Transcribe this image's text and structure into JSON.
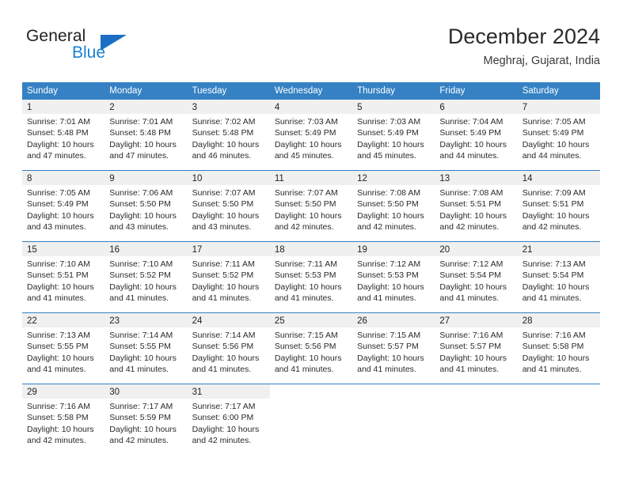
{
  "logo": {
    "word_top": "General",
    "word_bottom": "Blue",
    "triangle_icon": "blue-triangle-icon",
    "accent_color": "#1a7fd4"
  },
  "header": {
    "title": "December 2024",
    "location": "Meghraj, Gujarat, India"
  },
  "calendar": {
    "header_color": "#3581c4",
    "day_band_color": "#f0f0f0",
    "weekdays": [
      "Sunday",
      "Monday",
      "Tuesday",
      "Wednesday",
      "Thursday",
      "Friday",
      "Saturday"
    ],
    "weeks": [
      [
        {
          "day": "1",
          "sunrise": "Sunrise: 7:01 AM",
          "sunset": "Sunset: 5:48 PM",
          "daylight1": "Daylight: 10 hours",
          "daylight2": "and 47 minutes."
        },
        {
          "day": "2",
          "sunrise": "Sunrise: 7:01 AM",
          "sunset": "Sunset: 5:48 PM",
          "daylight1": "Daylight: 10 hours",
          "daylight2": "and 47 minutes."
        },
        {
          "day": "3",
          "sunrise": "Sunrise: 7:02 AM",
          "sunset": "Sunset: 5:48 PM",
          "daylight1": "Daylight: 10 hours",
          "daylight2": "and 46 minutes."
        },
        {
          "day": "4",
          "sunrise": "Sunrise: 7:03 AM",
          "sunset": "Sunset: 5:49 PM",
          "daylight1": "Daylight: 10 hours",
          "daylight2": "and 45 minutes."
        },
        {
          "day": "5",
          "sunrise": "Sunrise: 7:03 AM",
          "sunset": "Sunset: 5:49 PM",
          "daylight1": "Daylight: 10 hours",
          "daylight2": "and 45 minutes."
        },
        {
          "day": "6",
          "sunrise": "Sunrise: 7:04 AM",
          "sunset": "Sunset: 5:49 PM",
          "daylight1": "Daylight: 10 hours",
          "daylight2": "and 44 minutes."
        },
        {
          "day": "7",
          "sunrise": "Sunrise: 7:05 AM",
          "sunset": "Sunset: 5:49 PM",
          "daylight1": "Daylight: 10 hours",
          "daylight2": "and 44 minutes."
        }
      ],
      [
        {
          "day": "8",
          "sunrise": "Sunrise: 7:05 AM",
          "sunset": "Sunset: 5:49 PM",
          "daylight1": "Daylight: 10 hours",
          "daylight2": "and 43 minutes."
        },
        {
          "day": "9",
          "sunrise": "Sunrise: 7:06 AM",
          "sunset": "Sunset: 5:50 PM",
          "daylight1": "Daylight: 10 hours",
          "daylight2": "and 43 minutes."
        },
        {
          "day": "10",
          "sunrise": "Sunrise: 7:07 AM",
          "sunset": "Sunset: 5:50 PM",
          "daylight1": "Daylight: 10 hours",
          "daylight2": "and 43 minutes."
        },
        {
          "day": "11",
          "sunrise": "Sunrise: 7:07 AM",
          "sunset": "Sunset: 5:50 PM",
          "daylight1": "Daylight: 10 hours",
          "daylight2": "and 42 minutes."
        },
        {
          "day": "12",
          "sunrise": "Sunrise: 7:08 AM",
          "sunset": "Sunset: 5:50 PM",
          "daylight1": "Daylight: 10 hours",
          "daylight2": "and 42 minutes."
        },
        {
          "day": "13",
          "sunrise": "Sunrise: 7:08 AM",
          "sunset": "Sunset: 5:51 PM",
          "daylight1": "Daylight: 10 hours",
          "daylight2": "and 42 minutes."
        },
        {
          "day": "14",
          "sunrise": "Sunrise: 7:09 AM",
          "sunset": "Sunset: 5:51 PM",
          "daylight1": "Daylight: 10 hours",
          "daylight2": "and 42 minutes."
        }
      ],
      [
        {
          "day": "15",
          "sunrise": "Sunrise: 7:10 AM",
          "sunset": "Sunset: 5:51 PM",
          "daylight1": "Daylight: 10 hours",
          "daylight2": "and 41 minutes."
        },
        {
          "day": "16",
          "sunrise": "Sunrise: 7:10 AM",
          "sunset": "Sunset: 5:52 PM",
          "daylight1": "Daylight: 10 hours",
          "daylight2": "and 41 minutes."
        },
        {
          "day": "17",
          "sunrise": "Sunrise: 7:11 AM",
          "sunset": "Sunset: 5:52 PM",
          "daylight1": "Daylight: 10 hours",
          "daylight2": "and 41 minutes."
        },
        {
          "day": "18",
          "sunrise": "Sunrise: 7:11 AM",
          "sunset": "Sunset: 5:53 PM",
          "daylight1": "Daylight: 10 hours",
          "daylight2": "and 41 minutes."
        },
        {
          "day": "19",
          "sunrise": "Sunrise: 7:12 AM",
          "sunset": "Sunset: 5:53 PM",
          "daylight1": "Daylight: 10 hours",
          "daylight2": "and 41 minutes."
        },
        {
          "day": "20",
          "sunrise": "Sunrise: 7:12 AM",
          "sunset": "Sunset: 5:54 PM",
          "daylight1": "Daylight: 10 hours",
          "daylight2": "and 41 minutes."
        },
        {
          "day": "21",
          "sunrise": "Sunrise: 7:13 AM",
          "sunset": "Sunset: 5:54 PM",
          "daylight1": "Daylight: 10 hours",
          "daylight2": "and 41 minutes."
        }
      ],
      [
        {
          "day": "22",
          "sunrise": "Sunrise: 7:13 AM",
          "sunset": "Sunset: 5:55 PM",
          "daylight1": "Daylight: 10 hours",
          "daylight2": "and 41 minutes."
        },
        {
          "day": "23",
          "sunrise": "Sunrise: 7:14 AM",
          "sunset": "Sunset: 5:55 PM",
          "daylight1": "Daylight: 10 hours",
          "daylight2": "and 41 minutes."
        },
        {
          "day": "24",
          "sunrise": "Sunrise: 7:14 AM",
          "sunset": "Sunset: 5:56 PM",
          "daylight1": "Daylight: 10 hours",
          "daylight2": "and 41 minutes."
        },
        {
          "day": "25",
          "sunrise": "Sunrise: 7:15 AM",
          "sunset": "Sunset: 5:56 PM",
          "daylight1": "Daylight: 10 hours",
          "daylight2": "and 41 minutes."
        },
        {
          "day": "26",
          "sunrise": "Sunrise: 7:15 AM",
          "sunset": "Sunset: 5:57 PM",
          "daylight1": "Daylight: 10 hours",
          "daylight2": "and 41 minutes."
        },
        {
          "day": "27",
          "sunrise": "Sunrise: 7:16 AM",
          "sunset": "Sunset: 5:57 PM",
          "daylight1": "Daylight: 10 hours",
          "daylight2": "and 41 minutes."
        },
        {
          "day": "28",
          "sunrise": "Sunrise: 7:16 AM",
          "sunset": "Sunset: 5:58 PM",
          "daylight1": "Daylight: 10 hours",
          "daylight2": "and 41 minutes."
        }
      ],
      [
        {
          "day": "29",
          "sunrise": "Sunrise: 7:16 AM",
          "sunset": "Sunset: 5:58 PM",
          "daylight1": "Daylight: 10 hours",
          "daylight2": "and 42 minutes."
        },
        {
          "day": "30",
          "sunrise": "Sunrise: 7:17 AM",
          "sunset": "Sunset: 5:59 PM",
          "daylight1": "Daylight: 10 hours",
          "daylight2": "and 42 minutes."
        },
        {
          "day": "31",
          "sunrise": "Sunrise: 7:17 AM",
          "sunset": "Sunset: 6:00 PM",
          "daylight1": "Daylight: 10 hours",
          "daylight2": "and 42 minutes."
        },
        {
          "day": "",
          "sunrise": "",
          "sunset": "",
          "daylight1": "",
          "daylight2": ""
        },
        {
          "day": "",
          "sunrise": "",
          "sunset": "",
          "daylight1": "",
          "daylight2": ""
        },
        {
          "day": "",
          "sunrise": "",
          "sunset": "",
          "daylight1": "",
          "daylight2": ""
        },
        {
          "day": "",
          "sunrise": "",
          "sunset": "",
          "daylight1": "",
          "daylight2": ""
        }
      ]
    ]
  }
}
